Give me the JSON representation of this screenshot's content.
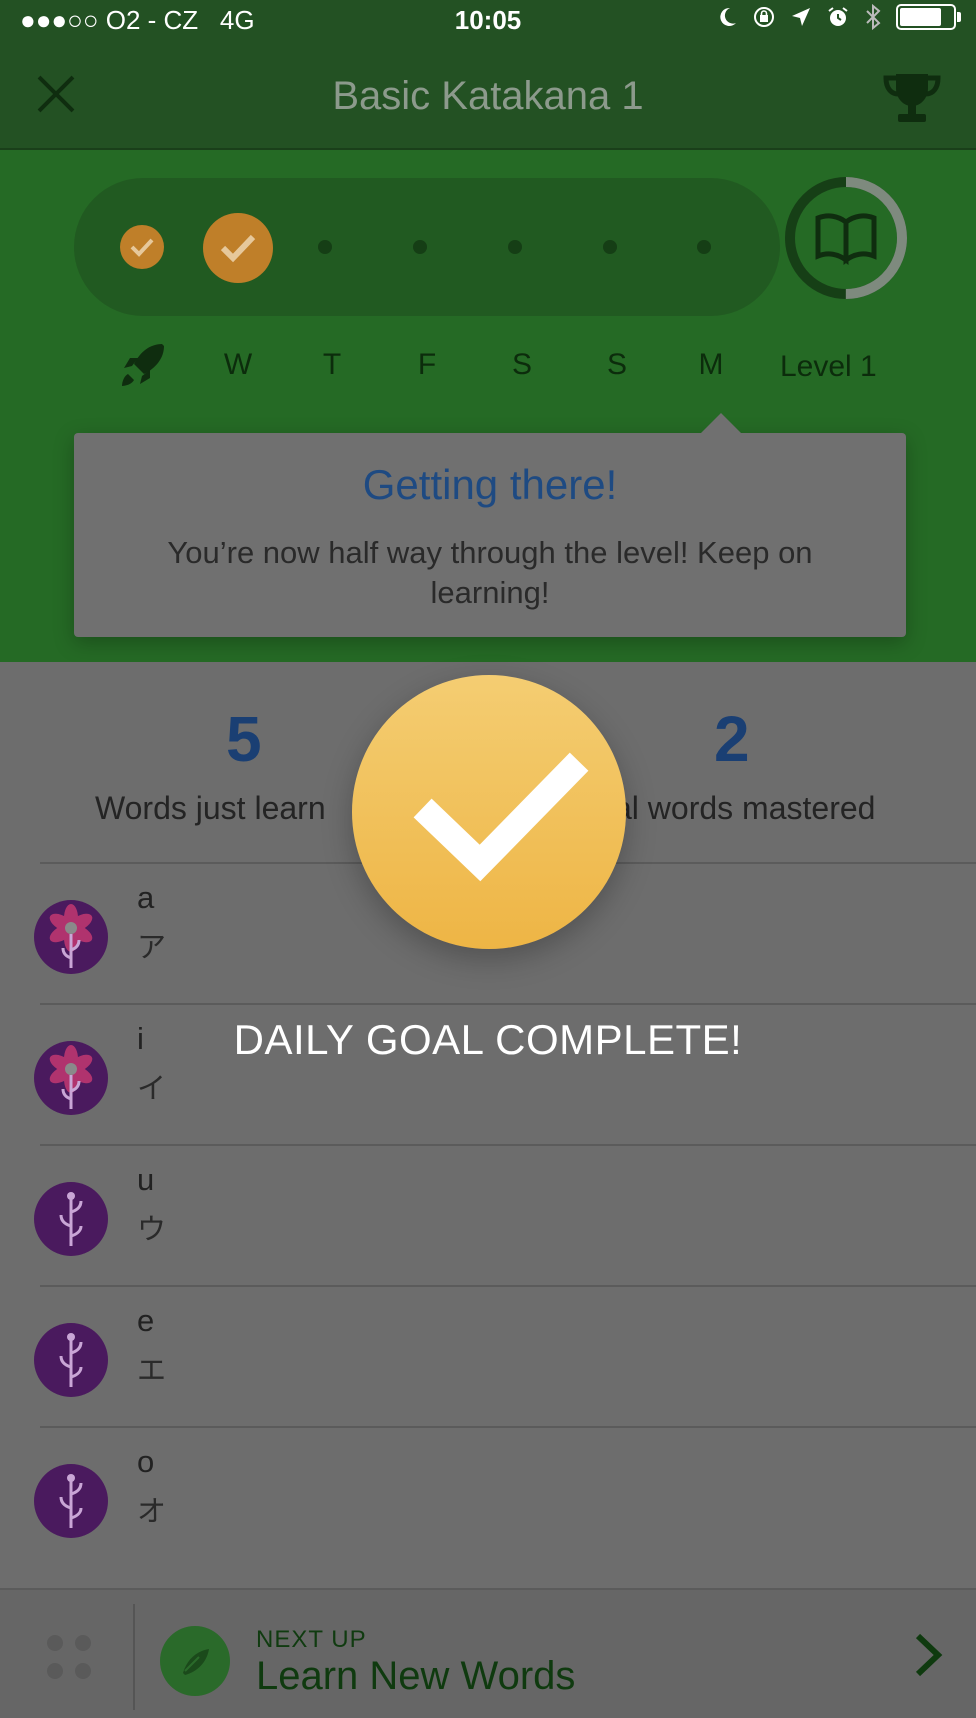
{
  "status_bar": {
    "carrier": "●●●○○ O2 - CZ",
    "network": "4G",
    "time": "10:05",
    "battery_level": 0.85
  },
  "header": {
    "title": "Basic Katakana 1",
    "close_icon": "close-icon",
    "trophy_icon": "trophy-icon"
  },
  "progress": {
    "days": [
      "W",
      "T",
      "F",
      "S",
      "S",
      "M"
    ],
    "completed_days": 2,
    "level_label": "Level 1",
    "level_progress": 0.5
  },
  "tooltip": {
    "title": "Getting there!",
    "body": "You’re now half way through the level! Keep on learning!"
  },
  "stats": {
    "learned_value": "5",
    "learned_label": "Words just learn",
    "mastered_value": "2",
    "mastered_label": "al words mastered"
  },
  "words": [
    {
      "word": "a",
      "kana": "ア",
      "icon": "flower-icon"
    },
    {
      "word": "i",
      "kana": "イ",
      "icon": "flower-icon"
    },
    {
      "word": "u",
      "kana": "ウ",
      "icon": "sprout-icon"
    },
    {
      "word": "e",
      "kana": "エ",
      "icon": "sprout-icon"
    },
    {
      "word": "o",
      "kana": "オ",
      "icon": "sprout-icon"
    }
  ],
  "overlay": {
    "message": "DAILY GOAL COMPLETE!",
    "icon": "checkmark-icon"
  },
  "next_up": {
    "label": "NEXT UP",
    "title": "Learn New Words"
  },
  "colors": {
    "header_green": "#235123",
    "hero_green": "#256a25",
    "gold": "#eeb545",
    "title_blue": "#1e4a82"
  }
}
